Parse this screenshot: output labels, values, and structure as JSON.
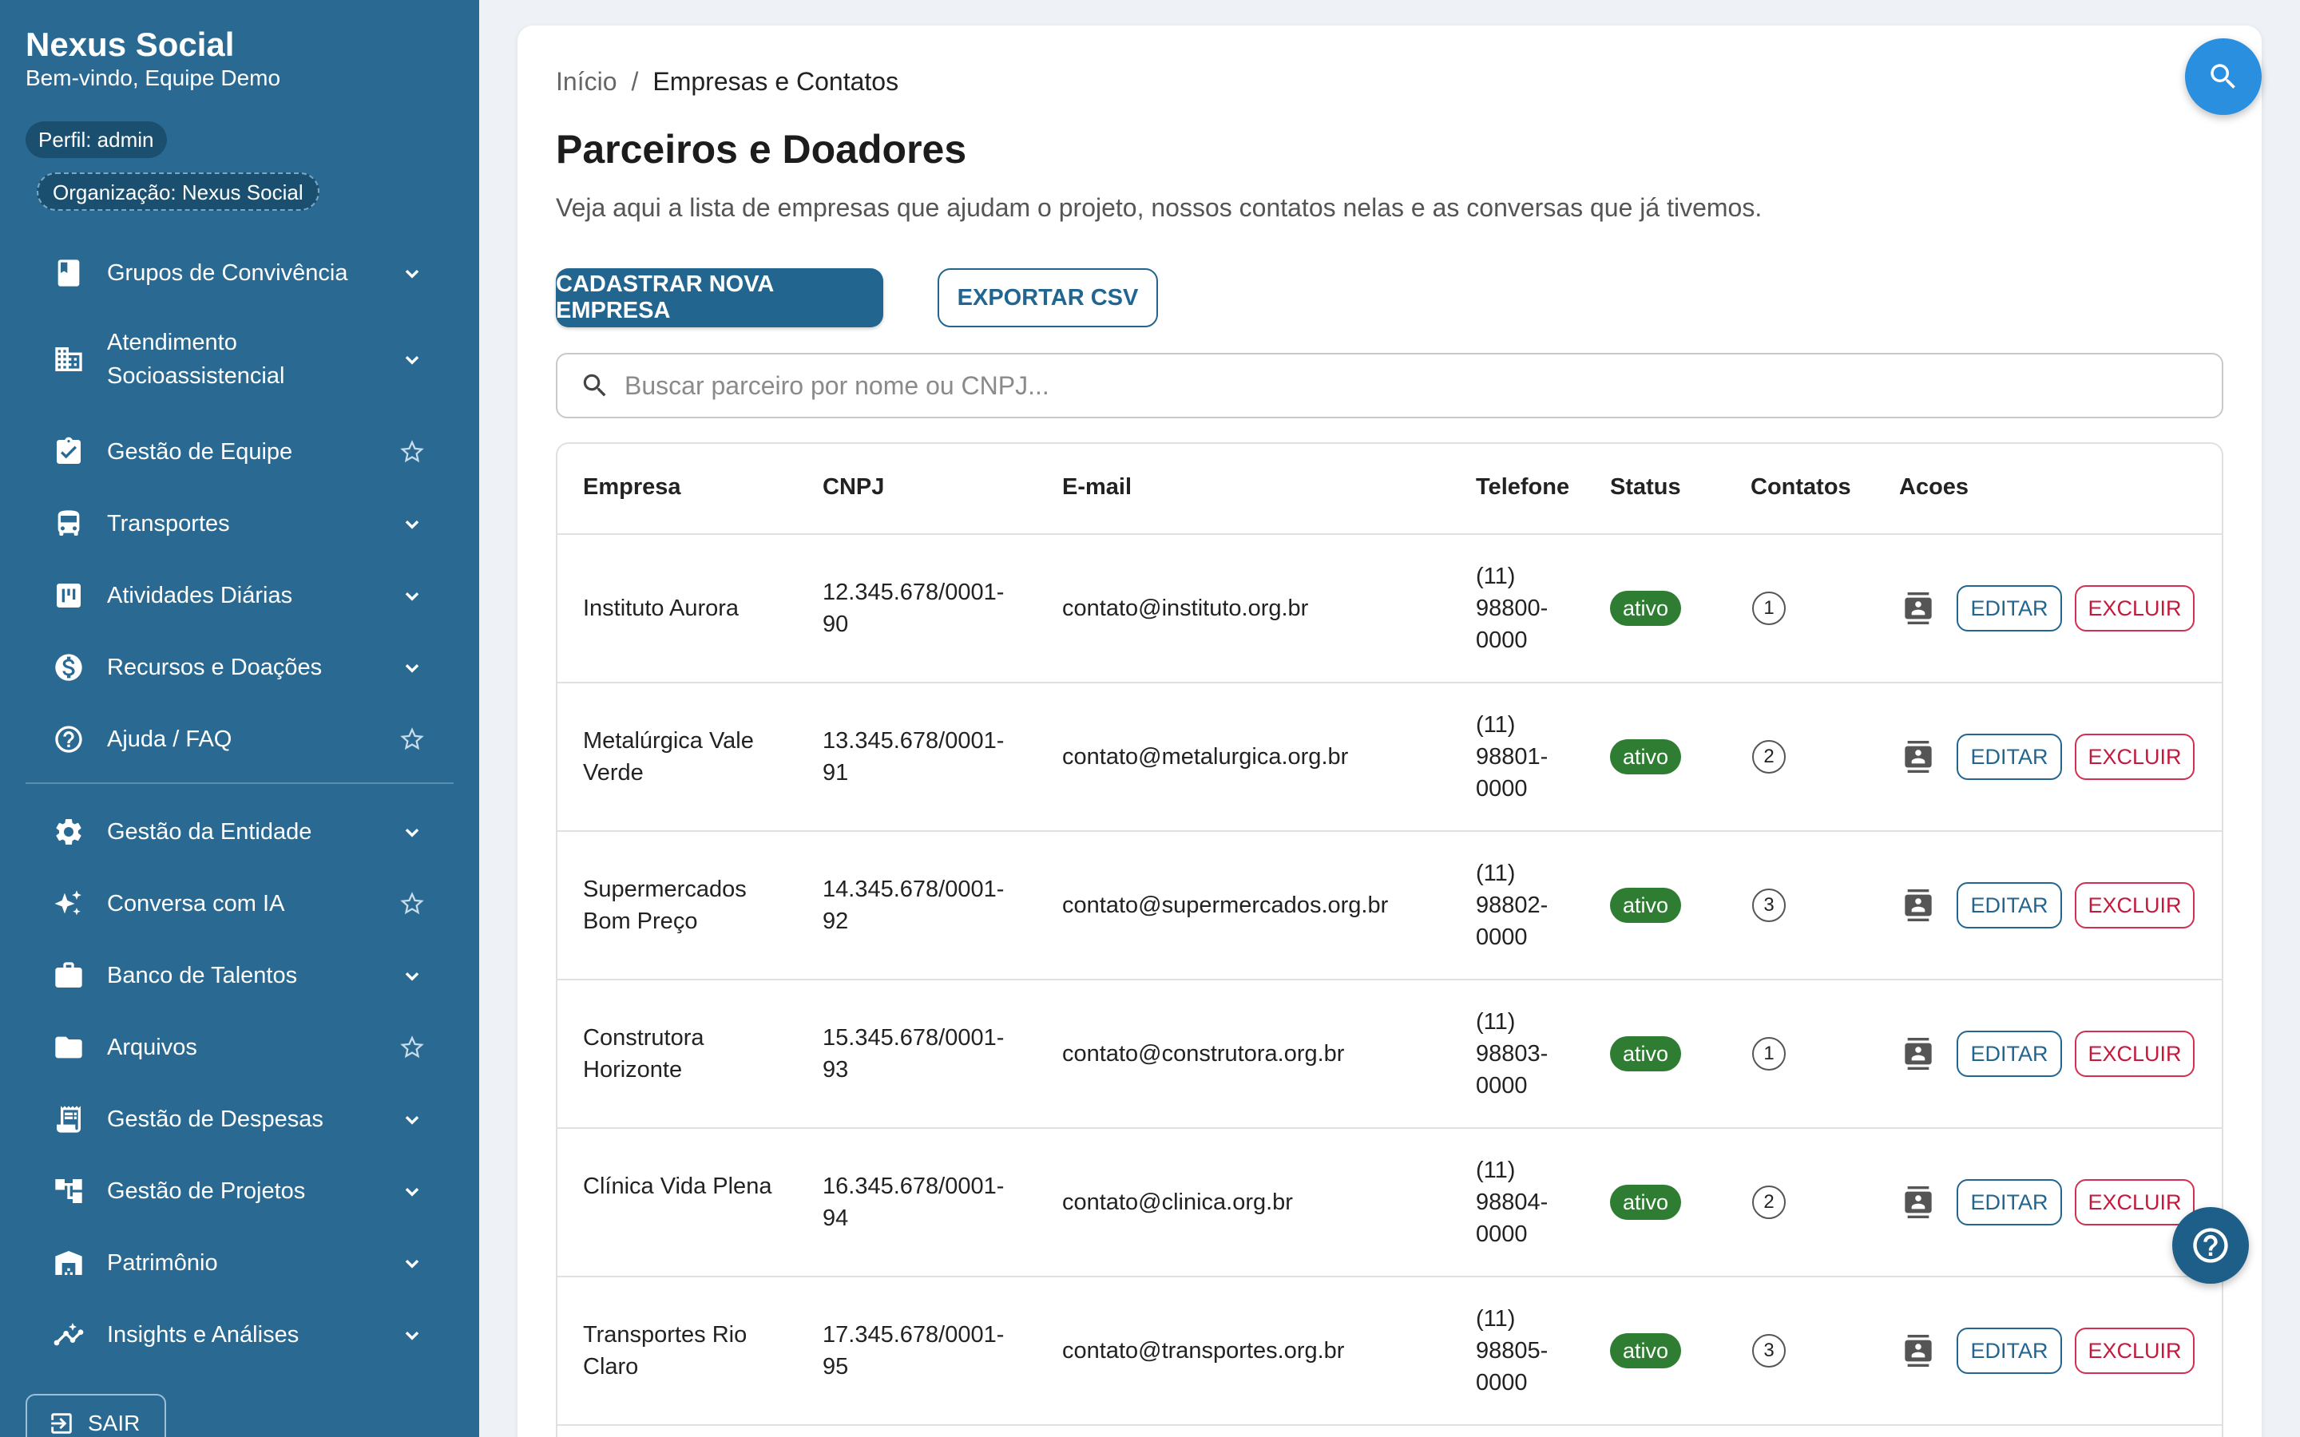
{
  "sidebar": {
    "brand": "Nexus Social",
    "welcome": "Bem-vindo, Equipe Demo",
    "role_chip": "Perfil: admin",
    "org_chip": "Organização: Nexus Social",
    "items": [
      {
        "label": "Grupos de Convivência",
        "icon": "book-icon",
        "trail": "chevron-down-icon"
      },
      {
        "label": "Atendimento Socioassistencial",
        "icon": "building-icon",
        "trail": "chevron-down-icon"
      },
      {
        "label": "Gestão de Equipe",
        "icon": "clipboard-check-icon",
        "trail": "star-icon"
      },
      {
        "label": "Transportes",
        "icon": "bus-icon",
        "trail": "chevron-down-icon"
      },
      {
        "label": "Atividades Diárias",
        "icon": "board-icon",
        "trail": "chevron-down-icon"
      },
      {
        "label": "Recursos e Doações",
        "icon": "dollar-icon",
        "trail": "chevron-down-icon"
      },
      {
        "label": "Ajuda / FAQ",
        "icon": "help-circle-icon",
        "trail": "star-icon"
      },
      {
        "label": "Gestão da Entidade",
        "icon": "gear-icon",
        "trail": "chevron-down-icon"
      },
      {
        "label": "Conversa com IA",
        "icon": "sparkle-icon",
        "trail": "star-icon"
      },
      {
        "label": "Banco de Talentos",
        "icon": "briefcase-icon",
        "trail": "chevron-down-icon"
      },
      {
        "label": "Arquivos",
        "icon": "folder-icon",
        "trail": "star-icon"
      },
      {
        "label": "Gestão de Despesas",
        "icon": "receipt-icon",
        "trail": "chevron-down-icon"
      },
      {
        "label": "Gestão de Projetos",
        "icon": "hierarchy-icon",
        "trail": "chevron-down-icon"
      },
      {
        "label": "Patrimônio",
        "icon": "warehouse-icon",
        "trail": "chevron-down-icon"
      },
      {
        "label": "Insights e Análises",
        "icon": "insights-icon",
        "trail": "chevron-down-icon"
      }
    ],
    "logout_label": "SAIR"
  },
  "breadcrumb": {
    "home": "Início",
    "separator": "/",
    "current": "Empresas e Contatos"
  },
  "page": {
    "title": "Parceiros e Doadores",
    "subtitle": "Veja aqui a lista de empresas que ajudam o projeto, nossos contatos nelas e as conversas que já tivemos."
  },
  "actions": {
    "primary": "CADASTRAR NOVA EMPRESA",
    "export": "EXPORTAR CSV"
  },
  "search": {
    "placeholder": "Buscar parceiro por nome ou CNPJ...",
    "value": ""
  },
  "table": {
    "headers": [
      "Empresa",
      "CNPJ",
      "E-mail",
      "Telefone",
      "Status",
      "Contatos",
      "Acoes"
    ],
    "rows": [
      {
        "name": "Instituto Aurora",
        "cnpj": "12.345.678/0001-90",
        "email": "contato@instituto.org.br",
        "phone": "(11) 98800-0000",
        "status": "ativo",
        "contacts": "1",
        "edit": "EDITAR",
        "delete": "EXCLUIR"
      },
      {
        "name": "Metalúrgica Vale Verde",
        "cnpj": "13.345.678/0001-91",
        "email": "contato@metalurgica.org.br",
        "phone": "(11) 98801-0000",
        "status": "ativo",
        "contacts": "2",
        "edit": "EDITAR",
        "delete": "EXCLUIR"
      },
      {
        "name": "Supermercados Bom Preço",
        "cnpj": "14.345.678/0001-92",
        "email": "contato@supermercados.org.br",
        "phone": "(11) 98802-0000",
        "status": "ativo",
        "contacts": "3",
        "edit": "EDITAR",
        "delete": "EXCLUIR"
      },
      {
        "name": "Construtora Horizonte",
        "cnpj": "15.345.678/0001-93",
        "email": "contato@construtora.org.br",
        "phone": "(11) 98803-0000",
        "status": "ativo",
        "contacts": "1",
        "edit": "EDITAR",
        "delete": "EXCLUIR"
      },
      {
        "name": "Clínica Vida Plena",
        "cnpj": "16.345.678/0001-94",
        "email": "contato@clinica.org.br",
        "phone": "(11) 98804-0000",
        "status": "ativo",
        "contacts": "2",
        "edit": "EDITAR",
        "delete": "EXCLUIR"
      },
      {
        "name": "Transportes Rio Claro",
        "cnpj": "17.345.678/0001-95",
        "email": "contato@transportes.org.br",
        "phone": "(11) 98805-0000",
        "status": "ativo",
        "contacts": "3",
        "edit": "EDITAR",
        "delete": "EXCLUIR"
      }
    ]
  },
  "colors": {
    "sidebar": "#2a6a92",
    "primary": "#22658f",
    "status_active": "#2e7d32",
    "danger": "#c3193d",
    "fab_search": "#2b8fe0"
  }
}
